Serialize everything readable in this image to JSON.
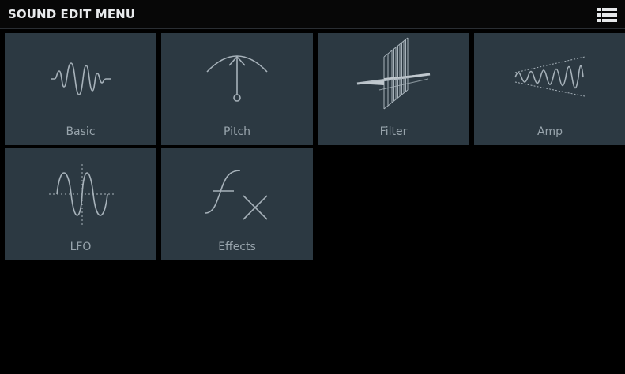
{
  "header": {
    "title": "SOUND EDIT MENU",
    "menu_icon": "list-menu-icon"
  },
  "tiles": [
    {
      "label": "Basic",
      "icon": "waveform-icon"
    },
    {
      "label": "Pitch",
      "icon": "pitch-arc-icon"
    },
    {
      "label": "Filter",
      "icon": "filter-plane-icon"
    },
    {
      "label": "Amp",
      "icon": "amp-envelope-icon"
    },
    {
      "label": "LFO",
      "icon": "lfo-sine-icon"
    },
    {
      "label": "Effects",
      "icon": "fx-icon"
    }
  ],
  "colors": {
    "background": "#000000",
    "header_bg": "#070707",
    "tile_bg": "#2c3942",
    "icon_stroke": "#a7b2ba",
    "label": "#98a4ac",
    "title": "#e8eaec"
  }
}
